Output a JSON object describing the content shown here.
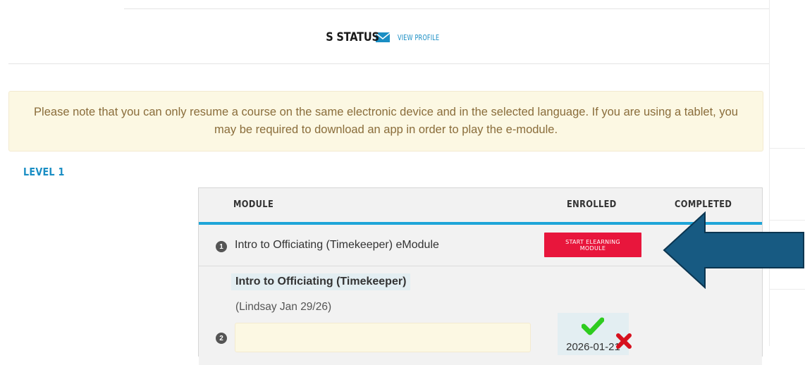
{
  "header": {
    "title": "S STATUS",
    "mail_icon": "envelope-icon",
    "view_profile": "VIEW PROFILE"
  },
  "notice": {
    "text": "Please note that you can only resume a course on the same electronic device and in the selected language. If you are using a tablet, you may be required to download an app in order to play the e-module."
  },
  "level": {
    "title": "LEVEL 1"
  },
  "table": {
    "headers": {
      "module": "MODULE",
      "enrolled": "ENROLLED",
      "completed": "COMPLETED"
    },
    "rows": [
      {
        "number": "1",
        "name": "Intro to Officiating (Timekeeper) eModule",
        "action_label": "START ELEARNING MODULE"
      },
      {
        "number": "2",
        "name": "Intro to Officiating (Timekeeper)",
        "subtitle": "(Lindsay Jan 29/26)",
        "enrolled_icon": "check-icon",
        "enrolled_date": "2026-01-21",
        "completed_icon": "x-icon"
      }
    ]
  },
  "colors": {
    "accent": "#1a8ec4",
    "button_red": "#e8163c",
    "notice_bg": "#fcf8e3",
    "notice_text": "#8a6d3b",
    "arrow_fill": "#175a82",
    "check_green": "#2ecc1f",
    "x_red": "#d6111e"
  },
  "annotation": {
    "arrow_icon": "left-arrow-icon"
  }
}
